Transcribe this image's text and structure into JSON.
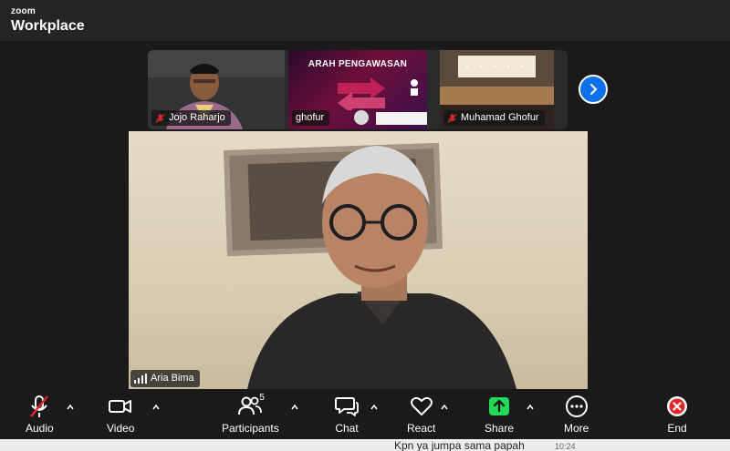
{
  "app": {
    "brand_small": "zoom",
    "brand_big": "Workplace"
  },
  "thumbnails": [
    {
      "name": "Jojo Raharjo",
      "muted": true
    },
    {
      "name": "ghofur",
      "muted": false,
      "slide_title": "ARAH PENGAWASAN"
    },
    {
      "name": "Muhamad Ghofur",
      "muted": true
    }
  ],
  "main_speaker": {
    "name": "Aria Bima"
  },
  "toolbar": {
    "audio": "Audio",
    "video": "Video",
    "participants": "Participants",
    "participants_count": "5",
    "chat": "Chat",
    "react": "React",
    "share": "Share",
    "more": "More",
    "end": "End"
  },
  "chat_peek": {
    "text": "Kpn ya jumpa sama papah",
    "time": "10:24"
  },
  "colors": {
    "accent_blue": "#0e71eb",
    "share_green": "#23d959",
    "end_red": "#e02828",
    "mute_red": "#e02828"
  },
  "icons": [
    "mic-muted-icon",
    "video-camera-icon",
    "participants-icon",
    "chat-icon",
    "heart-icon",
    "share-arrow-icon",
    "more-icon",
    "end-x-icon",
    "chevron-right-icon",
    "signal-bars-icon"
  ]
}
